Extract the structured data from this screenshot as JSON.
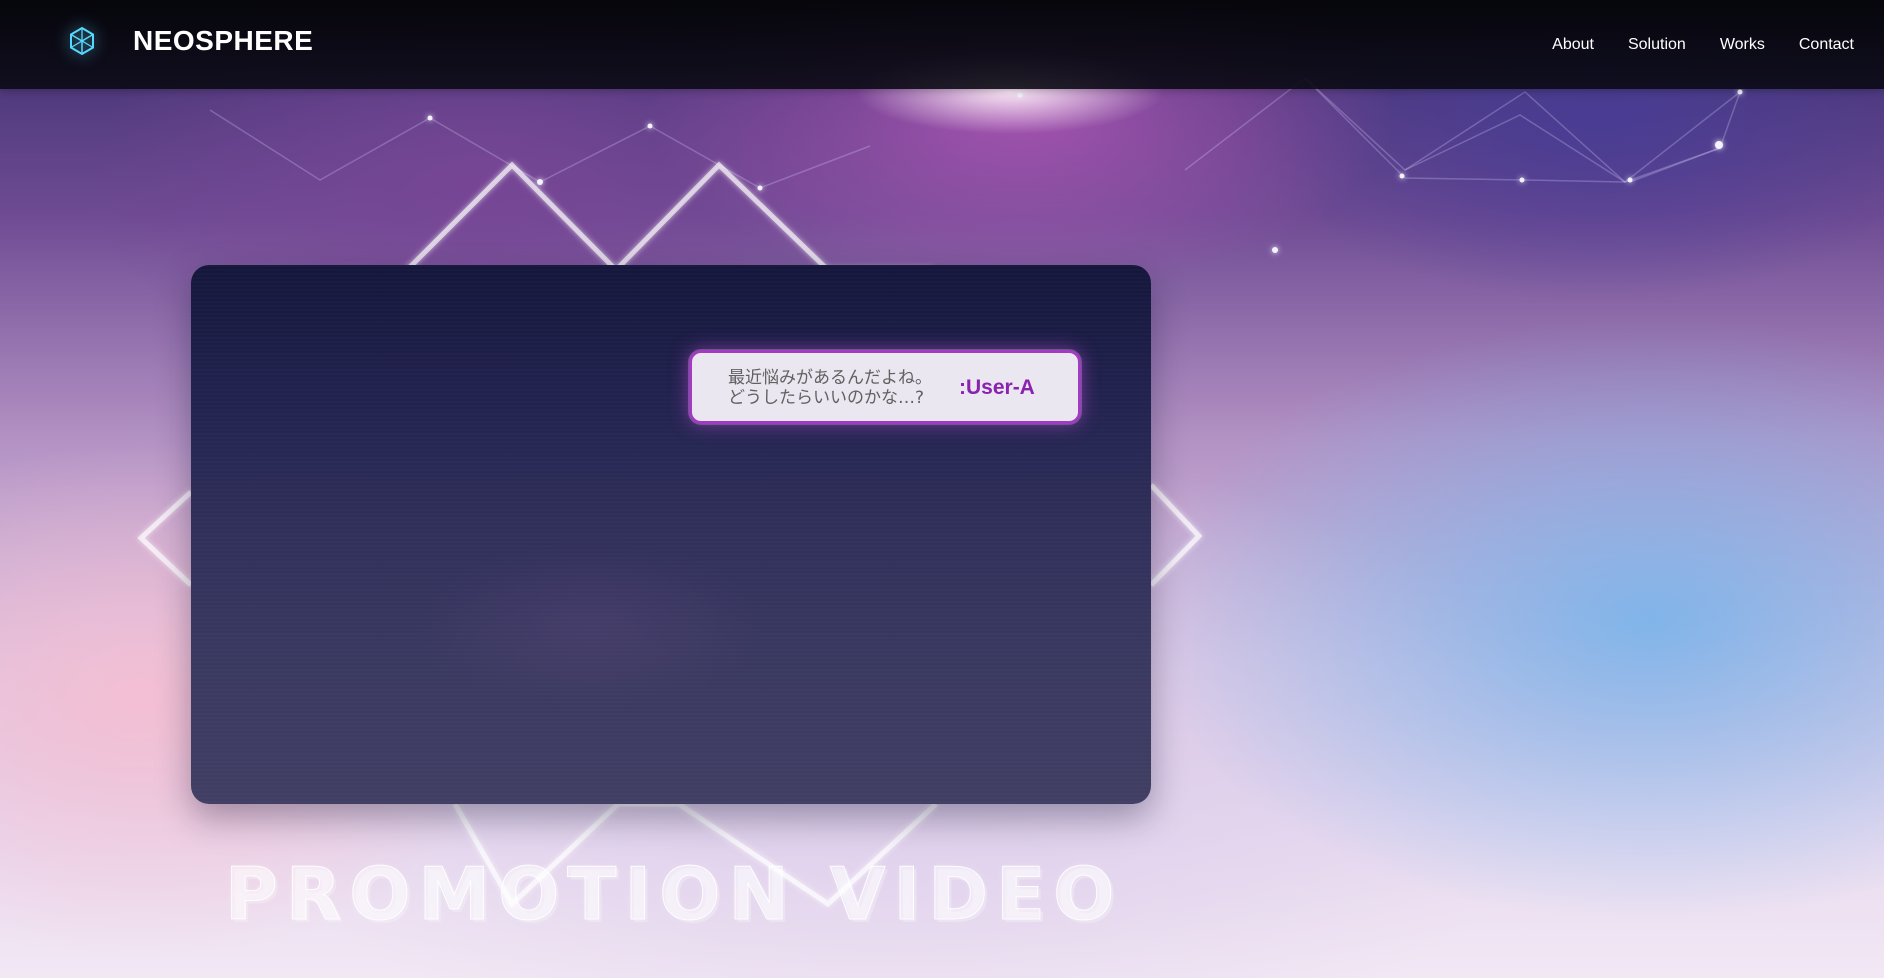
{
  "header": {
    "brand": "NEOSPHERE",
    "logo_icon": "cube-network-icon",
    "nav": [
      {
        "label": "About"
      },
      {
        "label": "Solution"
      },
      {
        "label": "Works"
      },
      {
        "label": "Contact"
      }
    ]
  },
  "hero": {
    "video": {
      "bubble_text": "最近悩みがあるんだよね。\nどうしたらいいのかな…?",
      "user_label": ":User-A"
    },
    "title": "PROMOTION VIDEO"
  },
  "colors": {
    "accent": "#8a22b0",
    "bubble_border": "#a13bc1",
    "logo_glow": "#55d8ff",
    "navbar": "#07080d"
  }
}
